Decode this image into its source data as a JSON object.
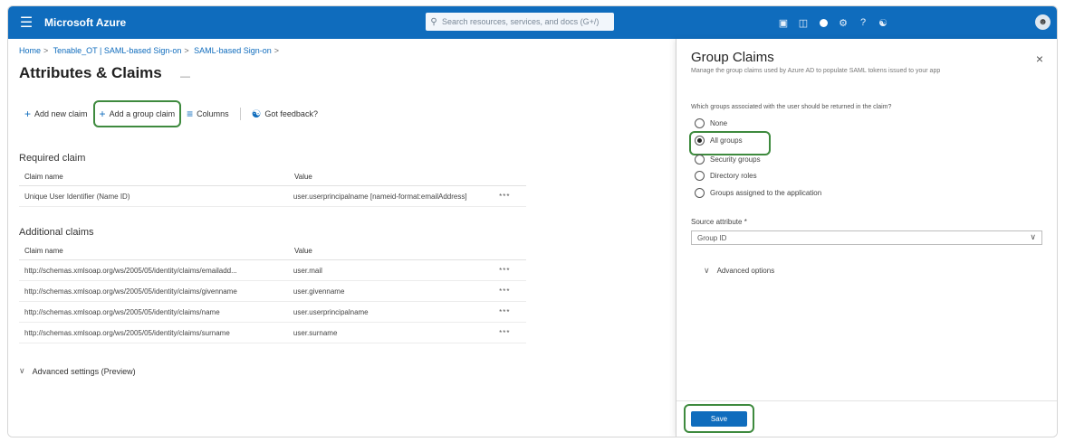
{
  "topbar": {
    "menu_icon": "hamburger-menu-icon",
    "brand": "Microsoft Azure",
    "search_placeholder": "Search resources, services, and docs (G+/)",
    "icons": [
      "cloud-shell-icon",
      "directory-filter-icon",
      "notifications-icon",
      "settings-icon",
      "help-icon",
      "feedback-icon"
    ],
    "account_label": "",
    "avatar": "user-avatar"
  },
  "breadcrumb": [
    "Home",
    "Tenable_OT | SAML-based Sign-on",
    "SAML-based Sign-on"
  ],
  "page": {
    "title": "Attributes & Claims",
    "more": "..."
  },
  "toolbar": {
    "add_new_claim": "Add new claim",
    "add_group_claim": "Add a group claim",
    "columns": "Columns",
    "got_feedback": "Got feedback?"
  },
  "required": {
    "title": "Required claim",
    "headers": [
      "Claim name",
      "Value"
    ],
    "rows": [
      {
        "name": "Unique User Identifier (Name ID)",
        "value": "user.userprincipalname [nameid-format:emailAddress]",
        "more": "***"
      }
    ]
  },
  "additional": {
    "title": "Additional claims",
    "headers": [
      "Claim name",
      "Value"
    ],
    "rows": [
      {
        "name": "http://schemas.xmlsoap.org/ws/2005/05/identity/claims/emailadd...",
        "value": "user.mail",
        "more": "***"
      },
      {
        "name": "http://schemas.xmlsoap.org/ws/2005/05/identity/claims/givenname",
        "value": "user.givenname",
        "more": "***"
      },
      {
        "name": "http://schemas.xmlsoap.org/ws/2005/05/identity/claims/name",
        "value": "user.userprincipalname",
        "more": "***"
      },
      {
        "name": "http://schemas.xmlsoap.org/ws/2005/05/identity/claims/surname",
        "value": "user.surname",
        "more": "***"
      }
    ]
  },
  "advanced_settings": "Advanced settings (Preview)",
  "panel": {
    "title": "Group Claims",
    "subtitle": "Manage the group claims used by Azure AD to populate SAML tokens issued to your app",
    "close": "×",
    "question": "Which groups associated with the user should be returned in the claim?",
    "options": [
      "None",
      "All groups",
      "Security groups",
      "Directory roles",
      "Groups assigned to the application"
    ],
    "selected_index": 1,
    "source_label": "Source attribute *",
    "source_value": "Group ID",
    "advanced_options": "Advanced options",
    "save": "Save"
  }
}
